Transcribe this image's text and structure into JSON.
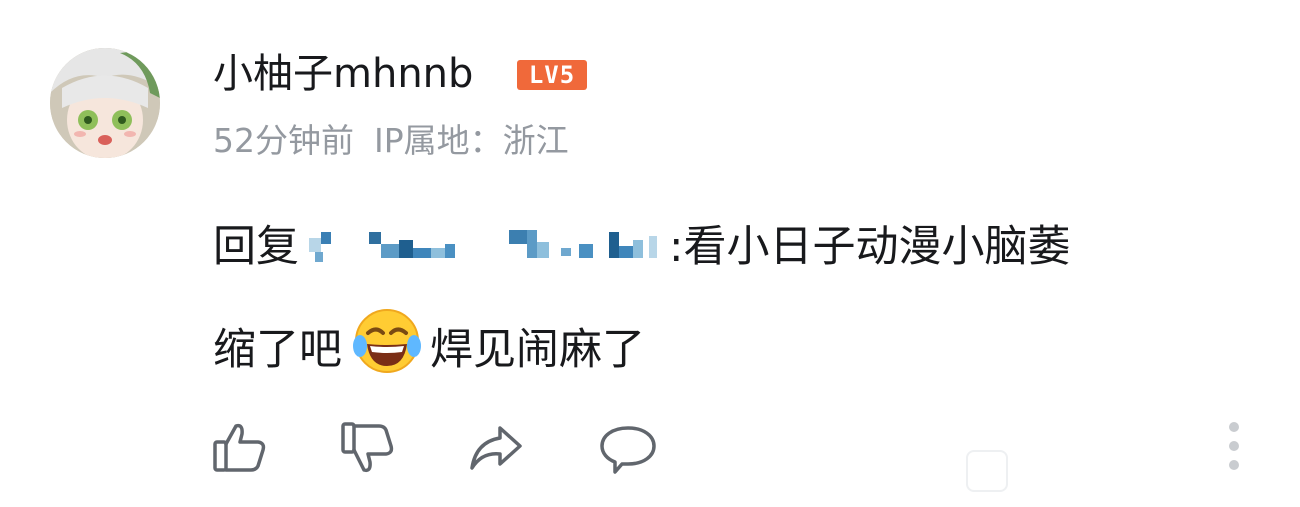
{
  "comment": {
    "username": "小柚子mhnnb",
    "level": "LV5",
    "time": "52分钟前",
    "ip_label": "IP属地：",
    "ip_location": "浙江",
    "reply_prefix": "回复",
    "text_line1": ":看小日子动漫小脑萎",
    "text_line2_a": "缩了吧",
    "text_line2_b": "焊见闹麻了",
    "emoji": "laughing-tears"
  },
  "colors": {
    "level_badge": "#f0693a",
    "meta_text": "#9499a0",
    "icon_stroke": "#61666d"
  },
  "actions": [
    "like-icon",
    "dislike-icon",
    "share-icon",
    "reply-icon",
    "more-icon"
  ]
}
